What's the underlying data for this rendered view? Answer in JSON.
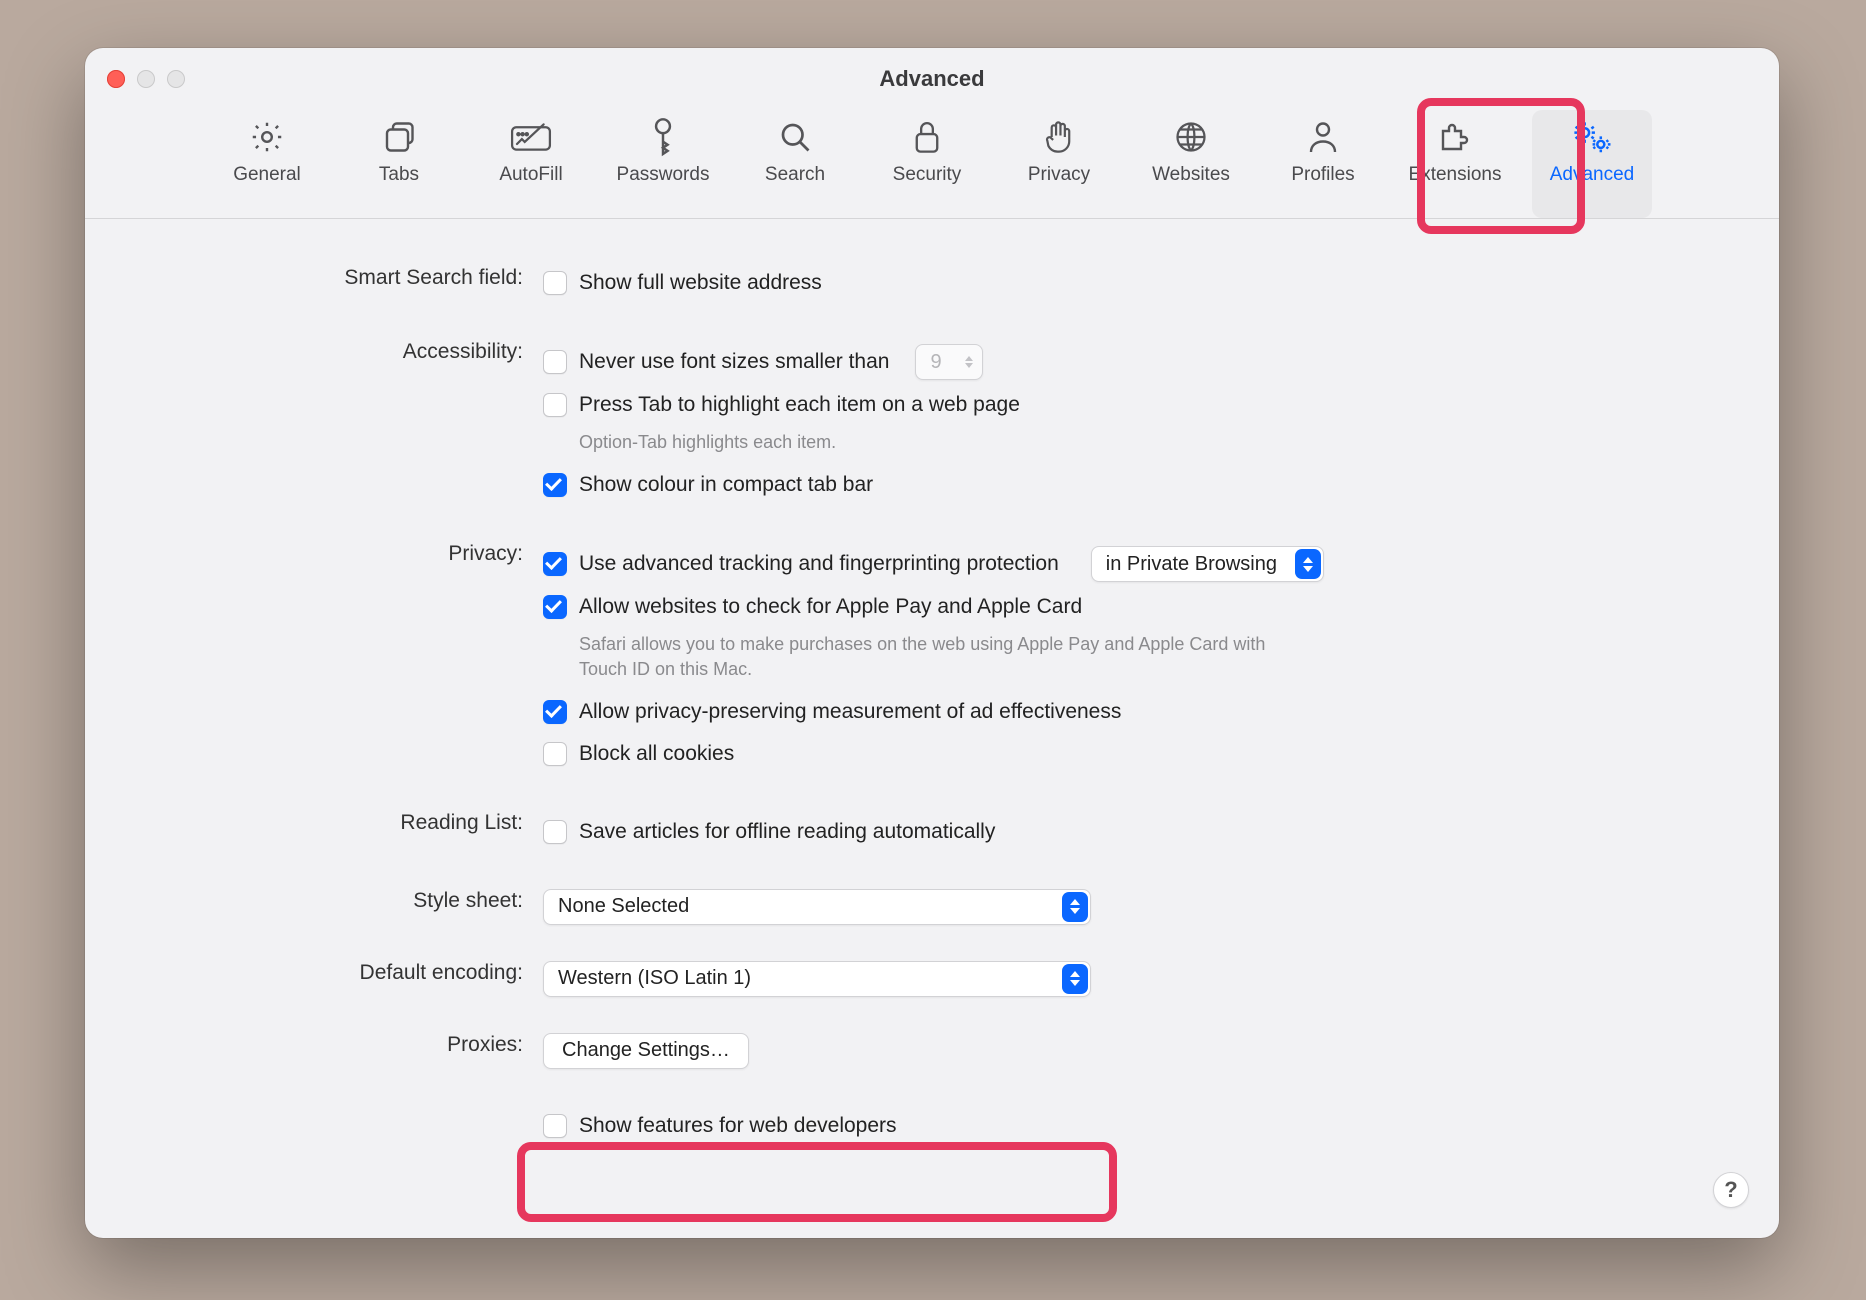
{
  "window": {
    "title": "Advanced"
  },
  "toolbar": {
    "items": [
      {
        "label": "General"
      },
      {
        "label": "Tabs"
      },
      {
        "label": "AutoFill"
      },
      {
        "label": "Passwords"
      },
      {
        "label": "Search"
      },
      {
        "label": "Security"
      },
      {
        "label": "Privacy"
      },
      {
        "label": "Websites"
      },
      {
        "label": "Profiles"
      },
      {
        "label": "Extensions"
      },
      {
        "label": "Advanced"
      }
    ],
    "active": "Advanced"
  },
  "sections": {
    "smart_search": {
      "label": "Smart Search field:",
      "show_full_url": {
        "text": "Show full website address",
        "checked": false
      }
    },
    "accessibility": {
      "label": "Accessibility:",
      "never_smaller": {
        "text": "Never use font sizes smaller than",
        "checked": false,
        "value": "9"
      },
      "press_tab": {
        "text": "Press Tab to highlight each item on a web page",
        "checked": false
      },
      "press_tab_hint": "Option-Tab highlights each item.",
      "compact_tab_color": {
        "text": "Show colour in compact tab bar",
        "checked": true
      }
    },
    "privacy": {
      "label": "Privacy:",
      "tracking": {
        "text": "Use advanced tracking and fingerprinting protection",
        "checked": true
      },
      "tracking_mode": {
        "options": [
          "in Private Browsing"
        ],
        "selected": "in Private Browsing"
      },
      "apple_pay": {
        "text": "Allow websites to check for Apple Pay and Apple Card",
        "checked": true
      },
      "apple_pay_hint": "Safari allows you to make purchases on the web using Apple Pay and Apple Card with Touch ID on this Mac.",
      "ad_measure": {
        "text": "Allow privacy-preserving measurement of ad effectiveness",
        "checked": true
      },
      "block_cookies": {
        "text": "Block all cookies",
        "checked": false
      }
    },
    "reading_list": {
      "label": "Reading List:",
      "save_offline": {
        "text": "Save articles for offline reading automatically",
        "checked": false
      }
    },
    "style_sheet": {
      "label": "Style sheet:",
      "selected": "None Selected"
    },
    "encoding": {
      "label": "Default encoding:",
      "selected": "Western (ISO Latin 1)"
    },
    "proxies": {
      "label": "Proxies:",
      "button": "Change Settings…"
    },
    "developer": {
      "show_dev": {
        "text": "Show features for web developers",
        "checked": false
      }
    }
  },
  "help": "?"
}
